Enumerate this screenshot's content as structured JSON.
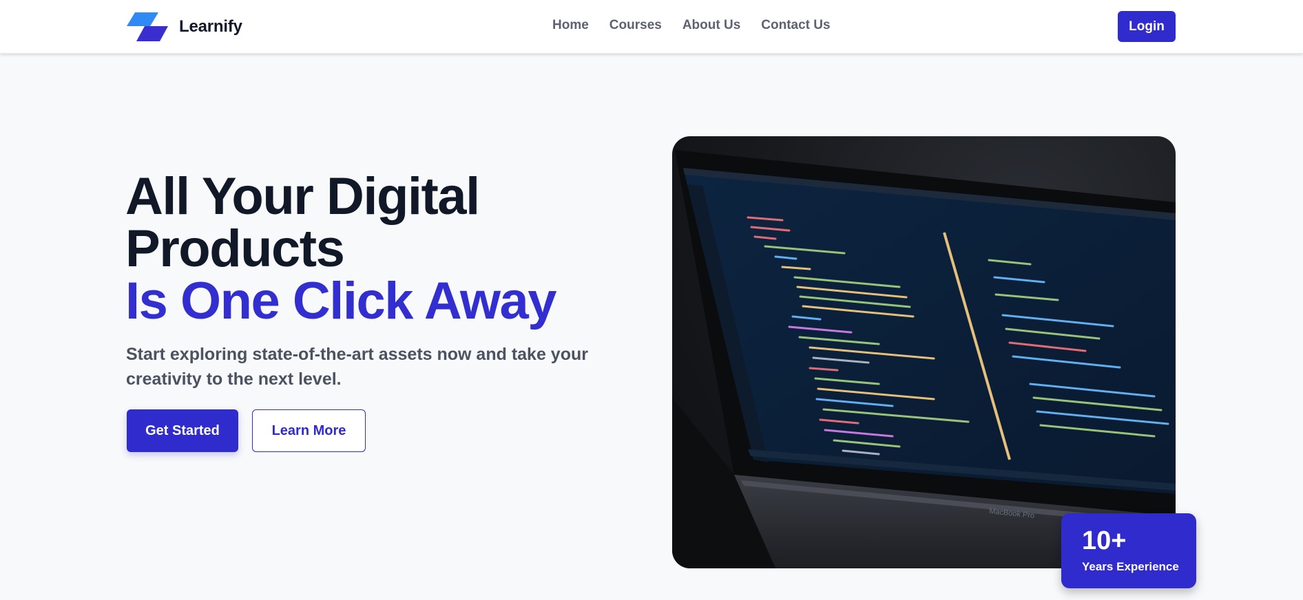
{
  "brand": {
    "name": "Learnify",
    "logo_icon": "stacked-parallelogram-logo"
  },
  "nav": {
    "links": [
      {
        "label": "Home"
      },
      {
        "label": "Courses"
      },
      {
        "label": "About Us"
      },
      {
        "label": "Contact Us"
      }
    ],
    "login_label": "Login"
  },
  "hero": {
    "title_line1": "All Your Digital",
    "title_line2": "Products",
    "title_accent": "Is One Click Away",
    "subtitle": "Start exploring state-of-the-art assets now and take your creativity to the next level.",
    "primary_button": "Get Started",
    "secondary_button": "Learn More",
    "image_subject": "laptop-showing-code-editor",
    "laptop_brand_text": "MacBook Pro"
  },
  "experience_badge": {
    "number": "10+",
    "label": "Years Experience"
  },
  "colors": {
    "primary": "#2f2bcd",
    "accent_text": "#332ecf",
    "heading": "#111827",
    "body_text": "#4b5260",
    "background": "#f8f9fb"
  }
}
